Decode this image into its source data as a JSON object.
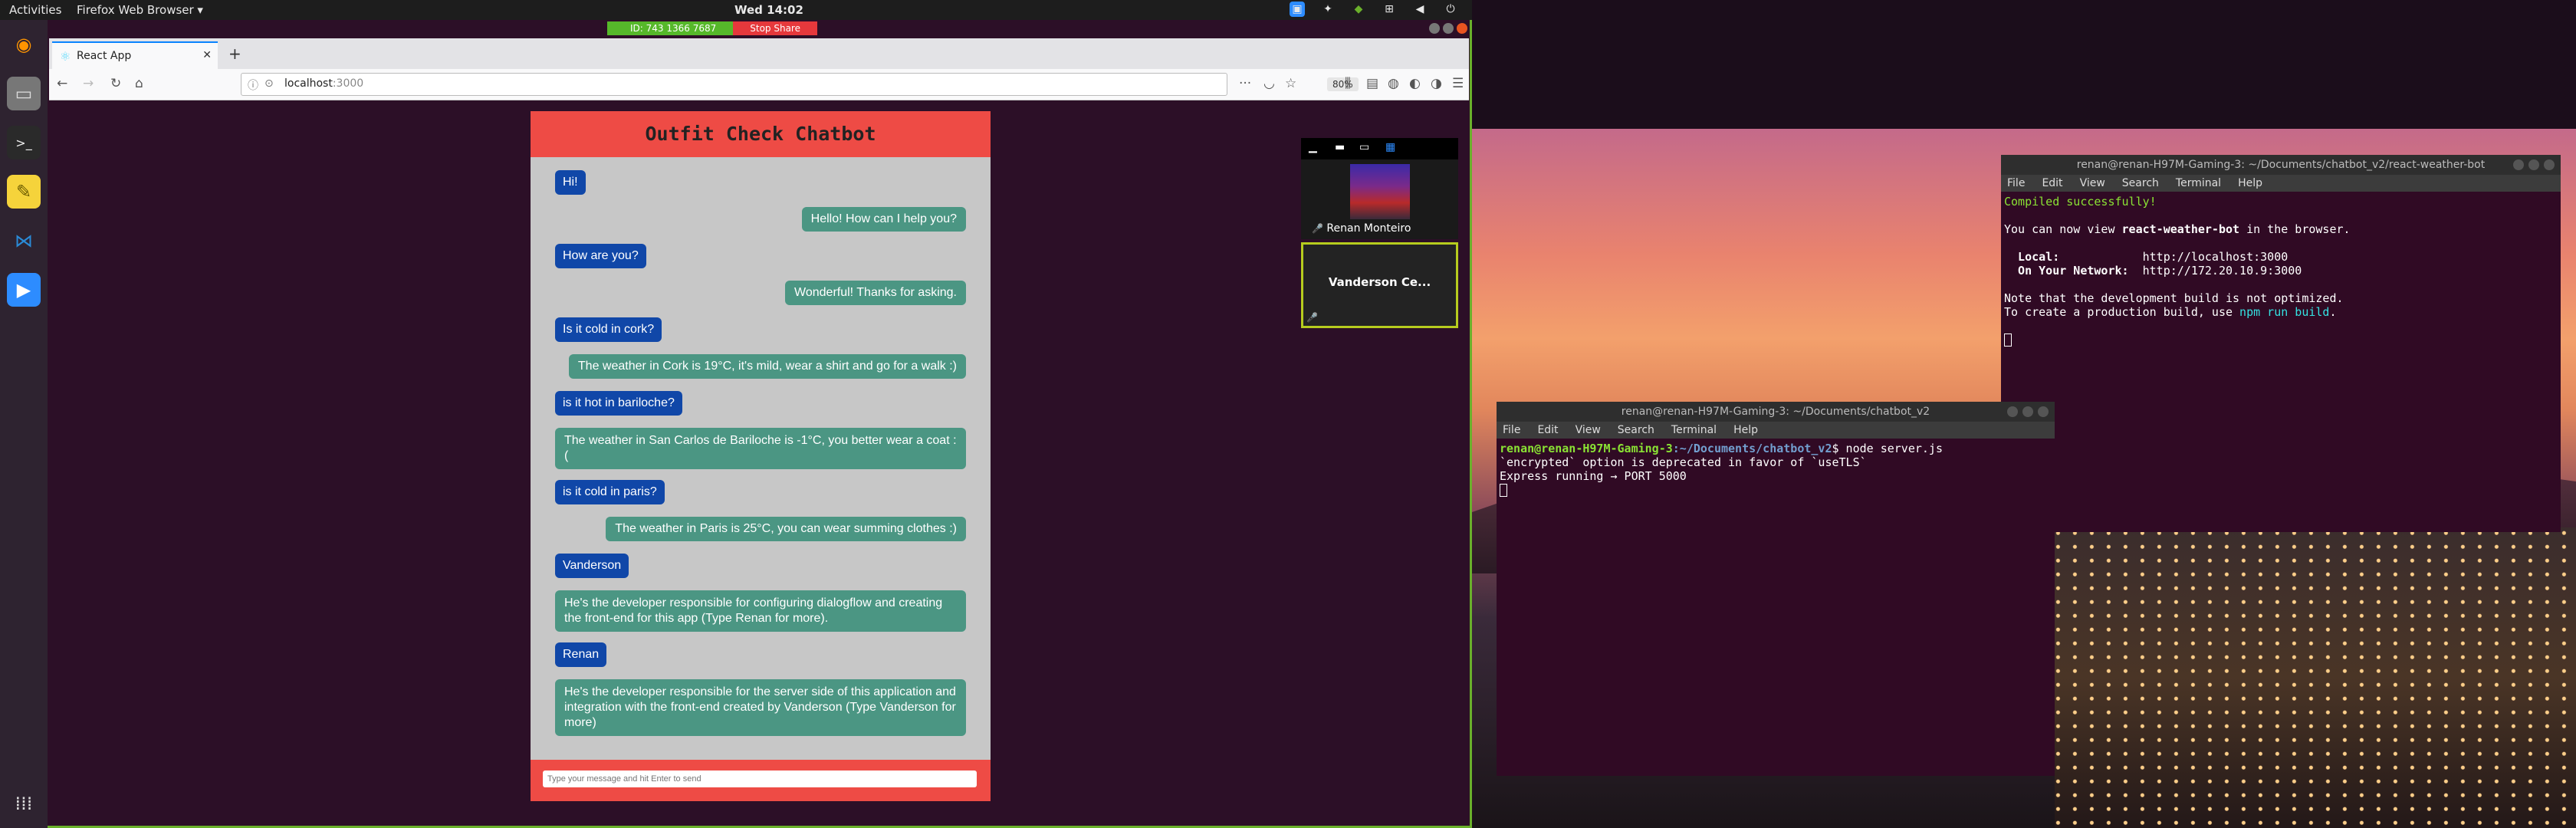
{
  "topbar": {
    "activities": "Activities",
    "app_menu": "Firefox Web Browser ▾",
    "clock": "Wed 14:02"
  },
  "screen_share": {
    "id_label": "ID: 743 1366 7687",
    "stop_label": "Stop Share"
  },
  "browser": {
    "tab_title": "React App",
    "url_host": "localhost",
    "url_port": ":3000",
    "zoom": "80%"
  },
  "chat": {
    "title": "Outfit Check Chatbot",
    "input_placeholder": "Type your message and hit Enter to send",
    "messages": [
      {
        "from": "bot",
        "text": "Hi!"
      },
      {
        "from": "user",
        "text": "Hello! How can I help you?"
      },
      {
        "from": "bot",
        "text": "How are you?"
      },
      {
        "from": "user",
        "text": "Wonderful! Thanks for asking."
      },
      {
        "from": "bot",
        "text": "Is it cold in cork?"
      },
      {
        "from": "user",
        "text": "The weather in Cork is 19°C, it's mild, wear a shirt and go for a walk :)"
      },
      {
        "from": "bot",
        "text": "is it hot in bariloche?"
      },
      {
        "from": "user",
        "text": "The weather in San Carlos de Bariloche is -1°C, you better wear a coat :("
      },
      {
        "from": "bot",
        "text": "is it cold in paris?"
      },
      {
        "from": "user",
        "text": "The weather in Paris is 25°C, you can wear summing clothes :)"
      },
      {
        "from": "bot",
        "text": "Vanderson"
      },
      {
        "from": "user",
        "text": "He's the developer responsible for configuring dialogflow and creating the front-end for this app (Type Renan for more)."
      },
      {
        "from": "bot",
        "text": "Renan"
      },
      {
        "from": "user",
        "text": "He's the developer responsible for the server side of this application and integration with the front-end created by Vanderson (Type Vanderson for more)"
      }
    ]
  },
  "zoom_panel": {
    "participant1": "Renan Monteiro",
    "participant2": "Vanderson Ce..."
  },
  "terminal_react": {
    "title": "renan@renan-H97M-Gaming-3: ~/Documents/chatbot_v2/react-weather-bot",
    "menu": [
      "File",
      "Edit",
      "View",
      "Search",
      "Terminal",
      "Help"
    ],
    "compiled": "Compiled successfully!",
    "view_pre": "You can now view ",
    "app_name": "react-weather-bot",
    "view_post": " in the browser.",
    "local_label": "  Local:",
    "local_url": "            http://localhost:3000",
    "net_label": "  On Your Network:",
    "net_url": "  http://172.20.10.9:3000",
    "note1": "Note that the development build is not optimized.",
    "note2_pre": "To create a production build, use ",
    "note2_cmd": "npm run build",
    "note2_post": "."
  },
  "terminal_server": {
    "title": "renan@renan-H97M-Gaming-3: ~/Documents/chatbot_v2",
    "menu": [
      "File",
      "Edit",
      "View",
      "Search",
      "Terminal",
      "Help"
    ],
    "prompt_user": "renan@renan-H97M-Gaming-3",
    "prompt_path": ":~/Documents/chatbot_v2",
    "command": "$ node server.js",
    "line2": "`encrypted` option is deprecated in favor of `useTLS`",
    "line3": "Express running → PORT 5000"
  }
}
